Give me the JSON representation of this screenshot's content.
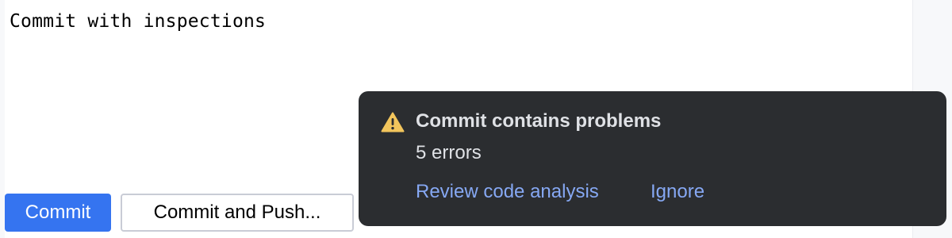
{
  "editor": {
    "commit_message": "Commit with inspections"
  },
  "buttons": {
    "commit_label": "Commit",
    "commit_push_label": "Commit and Push..."
  },
  "notification": {
    "icon": "warning-icon",
    "title": "Commit contains problems",
    "detail": "5 errors",
    "actions": [
      {
        "label": "Review code analysis"
      },
      {
        "label": "Ignore"
      }
    ],
    "colors": {
      "background": "#2b2d30",
      "text": "#dfe1e5",
      "link": "#86a8f3",
      "warning": "#f2c55c"
    }
  },
  "colors": {
    "primary_button": "#3574f0"
  }
}
